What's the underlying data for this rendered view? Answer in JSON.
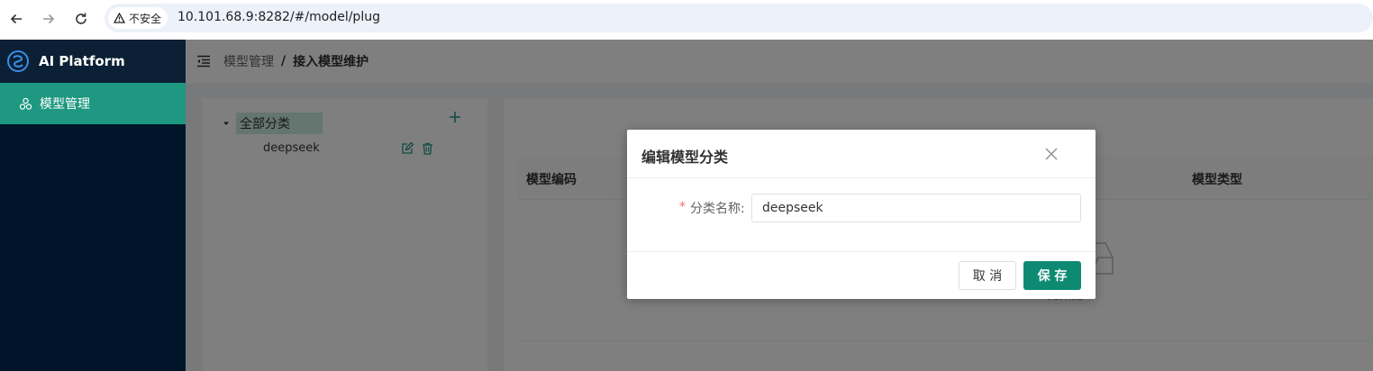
{
  "browser": {
    "back_icon": "arrow-left-icon",
    "forward_icon": "arrow-right-icon",
    "reload_icon": "reload-icon",
    "security_label": "不安全",
    "url": "10.101.68.9:8282/#/model/plug"
  },
  "sidebar": {
    "app_title": "AI Platform",
    "items": [
      {
        "label": "模型管理",
        "icon": "cluster-icon",
        "active": true
      }
    ]
  },
  "header": {
    "breadcrumb": [
      "模型管理",
      "接入模型维护"
    ],
    "separator": "/"
  },
  "tree": {
    "root_label": "全部分类",
    "children": [
      {
        "label": "deepseek"
      }
    ]
  },
  "table": {
    "columns": [
      "模型编码",
      "模型类型"
    ],
    "empty_text": "无数据"
  },
  "dialog": {
    "title": "编辑模型分类",
    "required_mark": "*",
    "field_label": "分类名称:",
    "field_value": "deepseek",
    "cancel_label": "取 消",
    "save_label": "保 存"
  },
  "colors": {
    "primary": "#1e9880",
    "sidebar_bg": "#001529",
    "save_button": "#0e8a73",
    "required": "#f56c6c"
  }
}
